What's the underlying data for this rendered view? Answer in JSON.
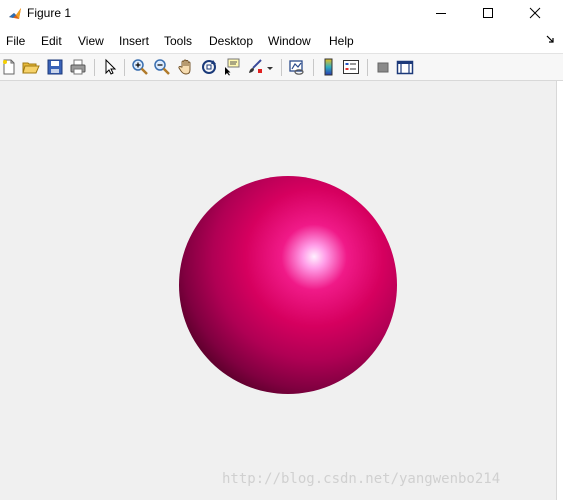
{
  "window": {
    "title": "Figure 1",
    "icon": "matlab-icon"
  },
  "menubar": {
    "items": [
      "File",
      "Edit",
      "View",
      "Insert",
      "Tools",
      "Desktop",
      "Window",
      "Help"
    ],
    "overflow_icon": "dock-arrow-icon"
  },
  "toolbar": {
    "buttons": [
      "new-figure-icon",
      "open-file-icon",
      "save-icon",
      "print-icon",
      "edit-plot-pointer-icon",
      "zoom-in-icon",
      "zoom-out-icon",
      "pan-hand-icon",
      "rotate-3d-icon",
      "data-cursor-icon",
      "brush-icon",
      "brush-dropdown-icon",
      "link-plot-icon",
      "insert-colorbar-icon",
      "insert-legend-icon",
      "hide-plot-tools-icon",
      "show-plot-tools-icon"
    ]
  },
  "figure": {
    "background_color": "#f0f0f0",
    "sphere_color": "#d6005f",
    "highlight_color": "#ffd6ff",
    "shadow_color": "#3a0018"
  },
  "watermark": {
    "text": "http://blog.csdn.net/yangwenbo214"
  }
}
